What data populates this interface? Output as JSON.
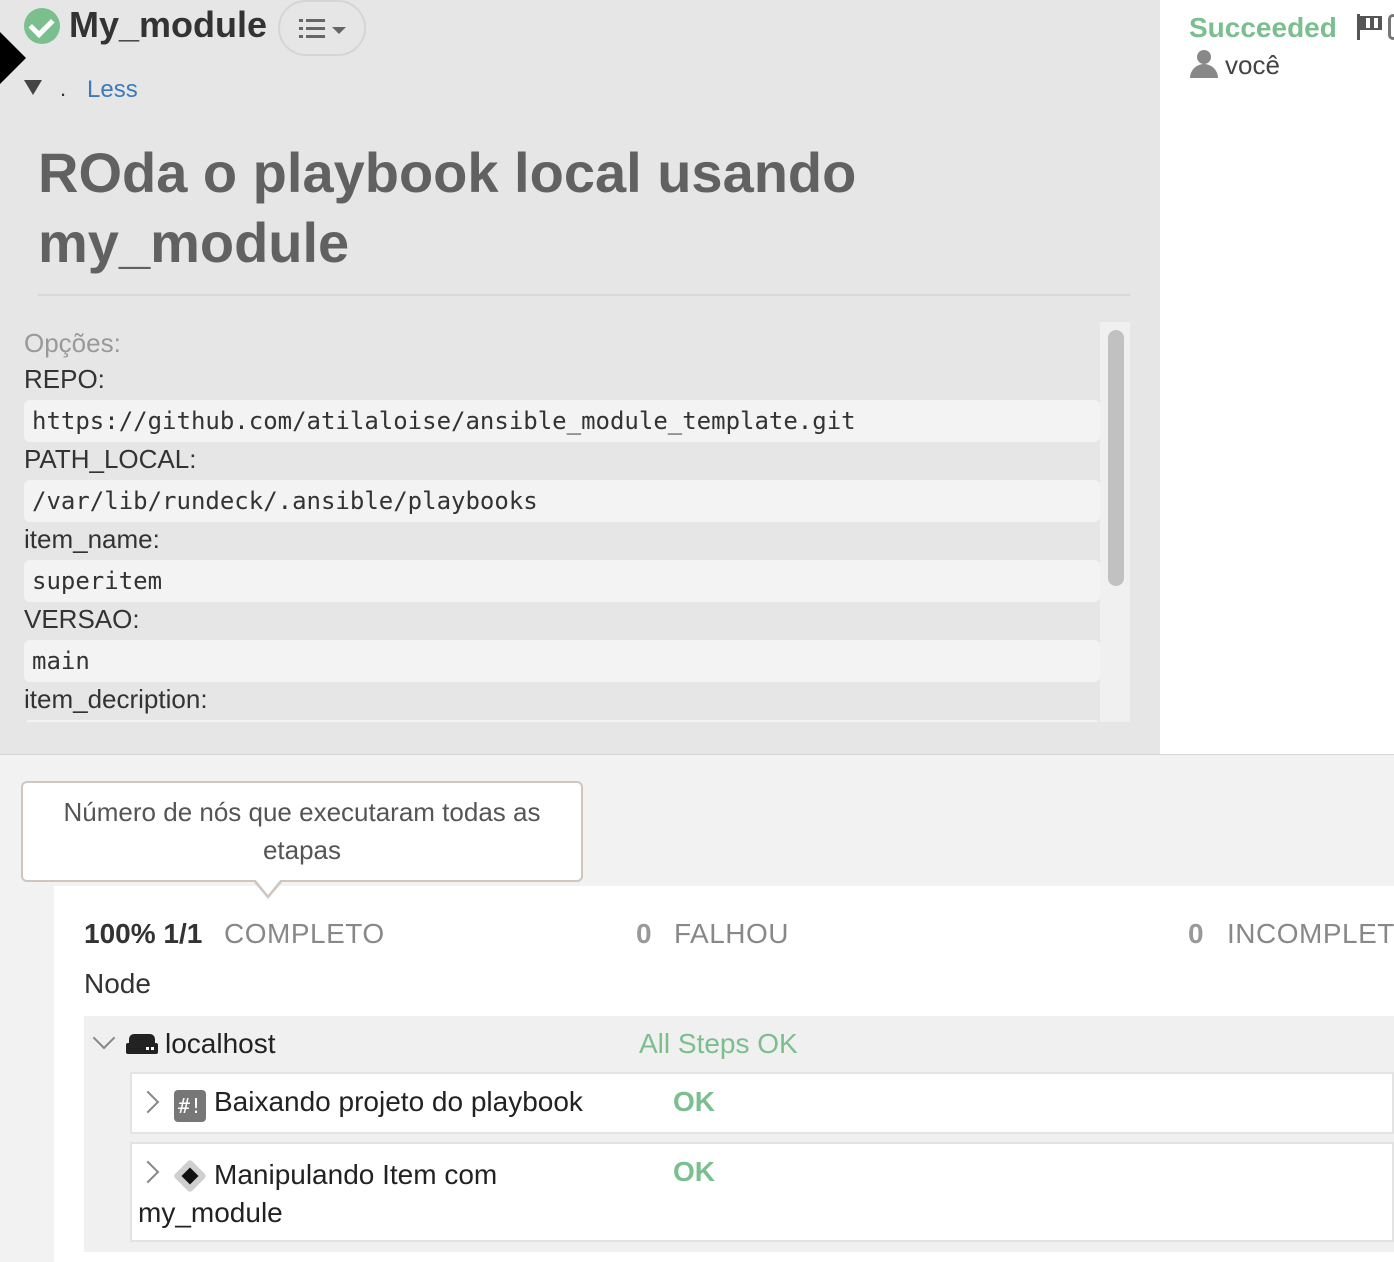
{
  "header": {
    "job_name": "My_module",
    "toggle_dot": ".",
    "less_link": "Less",
    "description_title": "ROda o playbook local usando my_module"
  },
  "options": {
    "label": "Opções:",
    "items": [
      {
        "key": "REPO:",
        "value": "https://github.com/atilaloise/ansible_module_template.git"
      },
      {
        "key": "PATH_LOCAL:",
        "value": "/var/lib/rundeck/.ansible/playbooks"
      },
      {
        "key": "item_name:",
        "value": "superitem"
      },
      {
        "key": "VERSAO:",
        "value": "main"
      },
      {
        "key": "item_decription:",
        "value": ""
      }
    ]
  },
  "execution": {
    "status": "Succeeded",
    "user": "você"
  },
  "tooltip": {
    "text": "Número de nós que executaram todas as etapas"
  },
  "summary": {
    "percent": "100% 1/1",
    "complete_label": "COMPLETO",
    "failed_count": "0",
    "failed_label": "FALHOU",
    "incomplete_count": "0",
    "incomplete_label": "INCOMPLETO"
  },
  "nodes": {
    "header": "Node",
    "node_name": "localhost",
    "node_status": "All Steps OK",
    "steps": [
      {
        "name": "Baixando projeto do playbook",
        "status": "OK",
        "icon": "script-icon",
        "icon_text": "#!"
      },
      {
        "name": "Manipulando Item com my_module",
        "status": "OK",
        "icon": "plugin-icon"
      }
    ]
  },
  "colors": {
    "success": "#7bbf8f",
    "link": "#3e7ab8"
  }
}
